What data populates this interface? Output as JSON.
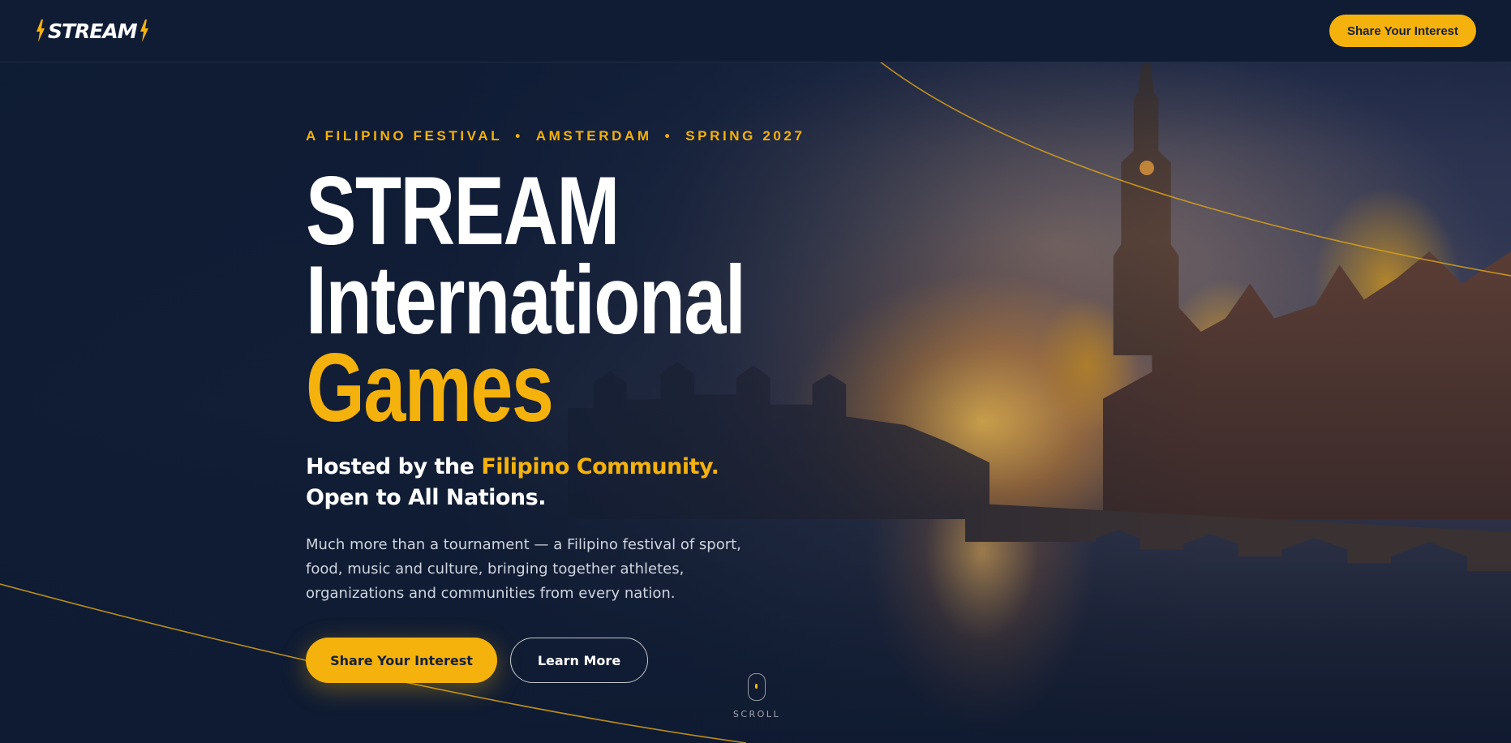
{
  "brand": {
    "name": "STREAM",
    "accent": "#f5b10c",
    "navy": "#0f1c34"
  },
  "header": {
    "cta_label": "Share Your Interest"
  },
  "hero": {
    "eyebrow": {
      "items": [
        "A FILIPINO FESTIVAL",
        "AMSTERDAM",
        "SPRING 2027"
      ],
      "separator": "•"
    },
    "title": {
      "line1": "STREAM",
      "line2": "International",
      "line3": "Games"
    },
    "subhead": {
      "prefix": "Hosted by the ",
      "highlight": "Filipino Community.",
      "line2": "Open to All Nations."
    },
    "lead": "Much more than a tournament — a Filipino festival of sport, food, music and culture, bringing together athletes, organizations and communities from every nation.",
    "cta_primary": "Share Your Interest",
    "cta_secondary": "Learn More"
  },
  "scroll": {
    "label": "SCROLL"
  },
  "icons": {
    "logo_bolt": "lightning-bolt-icon",
    "scroll": "mouse-icon"
  }
}
